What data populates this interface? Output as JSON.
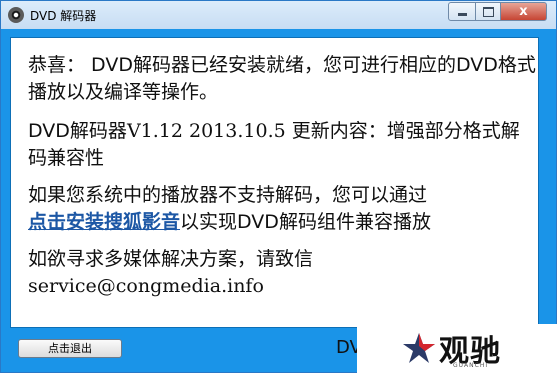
{
  "window": {
    "title": "DVD 解码器",
    "controls": {
      "close_glyph": "x"
    }
  },
  "content": {
    "para1": "恭喜： DVD解码器已经安装就绪，您可进行相应的DVD格式播放以及编译等操作。",
    "para2_prefix": "DVD解码器",
    "para2_version": "V1.12 2013.10.5",
    "para2_suffix": " 更新内容：增强部分格式解码兼容性",
    "para3_line1": "如果您系统中的播放器不支持解码，您可以通过",
    "para3_link": "点击安装搜狐影音",
    "para3_rest": "以实现DVD解码组件兼容播放",
    "para4_text": "如欲寻求多媒体解决方案，请致信",
    "para4_email": "service@congmedia.info"
  },
  "footer": {
    "exit_button": "点击退出",
    "status_text": "DV"
  },
  "watermark": {
    "text": "观驰",
    "sub": "GUANCHI"
  },
  "colors": {
    "window_frame": "#1a94e8",
    "link": "#1c57a5",
    "close_button": "#c64534"
  }
}
